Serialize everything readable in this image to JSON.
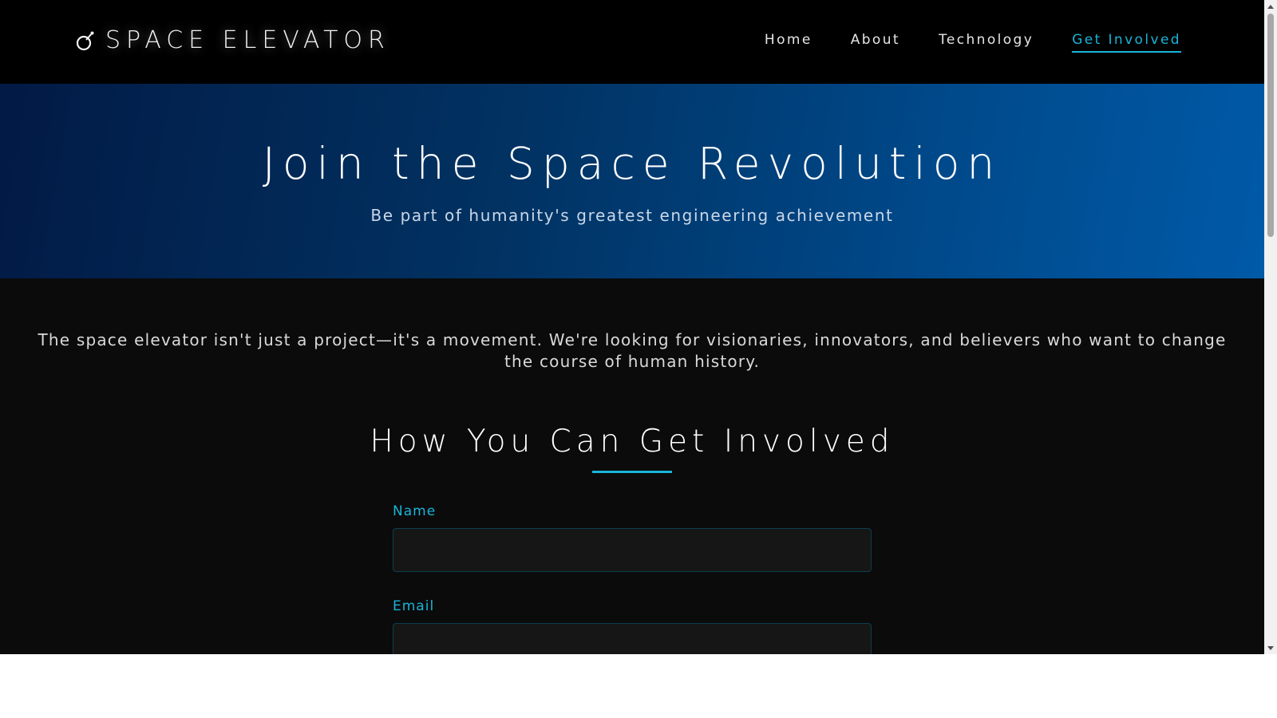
{
  "header": {
    "logo_text": "SPACE ELEVATOR",
    "logo_icon": "rocket-orbit-icon",
    "nav": [
      {
        "label": "Home",
        "active": false
      },
      {
        "label": "About",
        "active": false
      },
      {
        "label": "Technology",
        "active": false
      },
      {
        "label": "Get Involved",
        "active": true
      }
    ]
  },
  "hero": {
    "title": "Join the Space Revolution",
    "subtitle": "Be part of humanity's greatest engineering achievement"
  },
  "main": {
    "intro": "The space elevator isn't just a project—it's a movement. We're looking for visionaries, innovators, and believers who want to change the course of human history.",
    "section_title": "How You Can Get Involved",
    "form": {
      "name_label": "Name",
      "name_value": "",
      "email_label": "Email",
      "email_value": ""
    }
  },
  "colors": {
    "accent": "#19b4d8",
    "header_bg": "#000000",
    "page_bg": "#0b0b0b",
    "hero_gradient_start": "#021a45",
    "hero_gradient_end": "#005aa8"
  }
}
